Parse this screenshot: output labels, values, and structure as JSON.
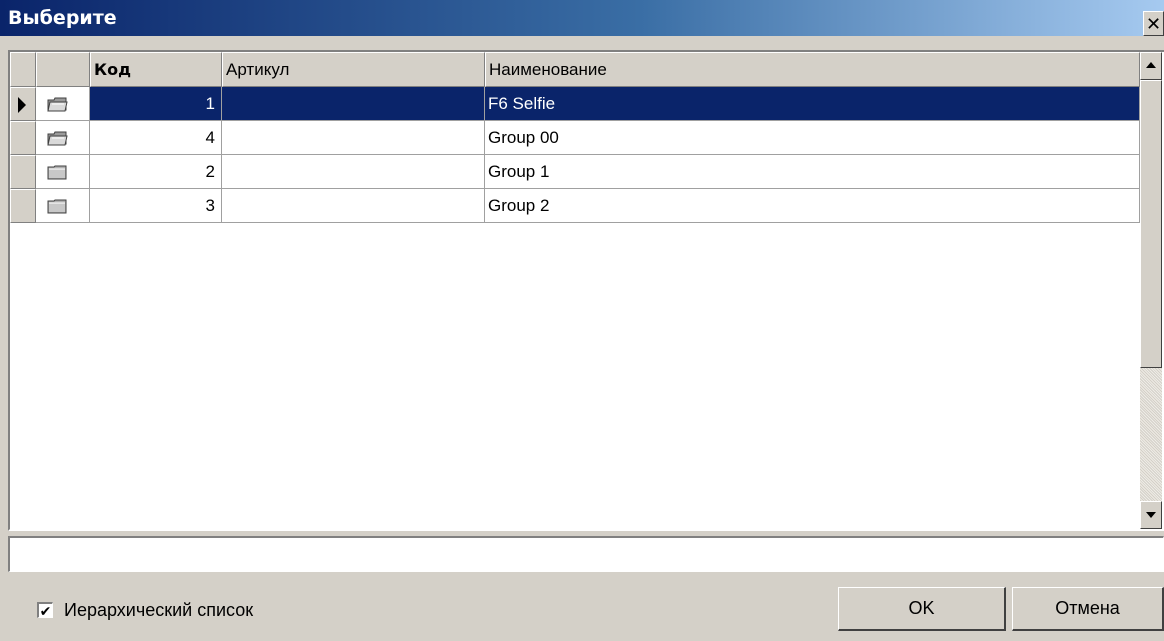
{
  "window": {
    "title": "Выберите",
    "close_symbol": "✕"
  },
  "grid": {
    "columns": [
      "",
      "Код",
      "Артикул",
      "Наименование"
    ],
    "rows": [
      {
        "code": "1",
        "article": "",
        "name": "F6 Selfie",
        "selected": true,
        "icon": "open-folder-icon"
      },
      {
        "code": "4",
        "article": "",
        "name": "Group 00",
        "selected": false,
        "icon": "open-folder-icon"
      },
      {
        "code": "2",
        "article": "",
        "name": "Group 1",
        "selected": false,
        "icon": "closed-folder-icon"
      },
      {
        "code": "3",
        "article": "",
        "name": "Group 2",
        "selected": false,
        "icon": "closed-folder-icon"
      }
    ],
    "selection_color": "#0a246a"
  },
  "status_field": {
    "value": ""
  },
  "footer": {
    "hierarchical_checkbox": {
      "label": "Иерархический список",
      "checked": true,
      "mark": "✔"
    },
    "ok_label": "OK",
    "cancel_label": "Отмена"
  }
}
